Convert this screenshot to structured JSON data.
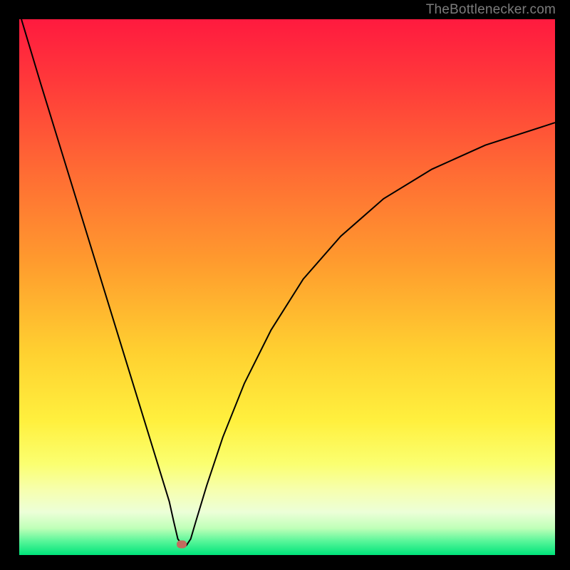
{
  "attribution": "TheBottlenecker.com",
  "marker": {
    "x_pct": 30.3,
    "y_pct": 98.0
  },
  "chart_data": {
    "type": "line",
    "title": "",
    "xlabel": "",
    "ylabel": "",
    "xlim": [
      0,
      100
    ],
    "ylim": [
      0,
      100
    ],
    "series": [
      {
        "name": "bottleneck-curve",
        "x": [
          0.4,
          4,
          8,
          12,
          16,
          20,
          24,
          26,
          28,
          28.8,
          29.6,
          30.5,
          31.2,
          32.0,
          33.0,
          35,
          38,
          42,
          47,
          53,
          60,
          68,
          77,
          87,
          100
        ],
        "y": [
          100,
          88,
          75,
          62,
          49,
          36,
          23,
          16.5,
          10,
          6.4,
          3.0,
          1.8,
          1.8,
          3.0,
          6.4,
          13,
          22,
          32,
          42,
          51.5,
          59.5,
          66.5,
          72,
          76.5,
          80.7
        ]
      }
    ],
    "background_gradient": {
      "stops": [
        {
          "pct": 0,
          "color": "#ff1a3f"
        },
        {
          "pct": 12,
          "color": "#ff3a3a"
        },
        {
          "pct": 28,
          "color": "#ff6a34"
        },
        {
          "pct": 45,
          "color": "#ff9a2e"
        },
        {
          "pct": 62,
          "color": "#ffd030"
        },
        {
          "pct": 75,
          "color": "#fff03e"
        },
        {
          "pct": 83,
          "color": "#fbff70"
        },
        {
          "pct": 88,
          "color": "#f6ffb0"
        },
        {
          "pct": 92,
          "color": "#ecffd8"
        },
        {
          "pct": 95,
          "color": "#bfffb8"
        },
        {
          "pct": 97.5,
          "color": "#55f598"
        },
        {
          "pct": 100,
          "color": "#00e47a"
        }
      ]
    },
    "curve_min_point": {
      "x": 30.3,
      "y": 1.8
    }
  }
}
